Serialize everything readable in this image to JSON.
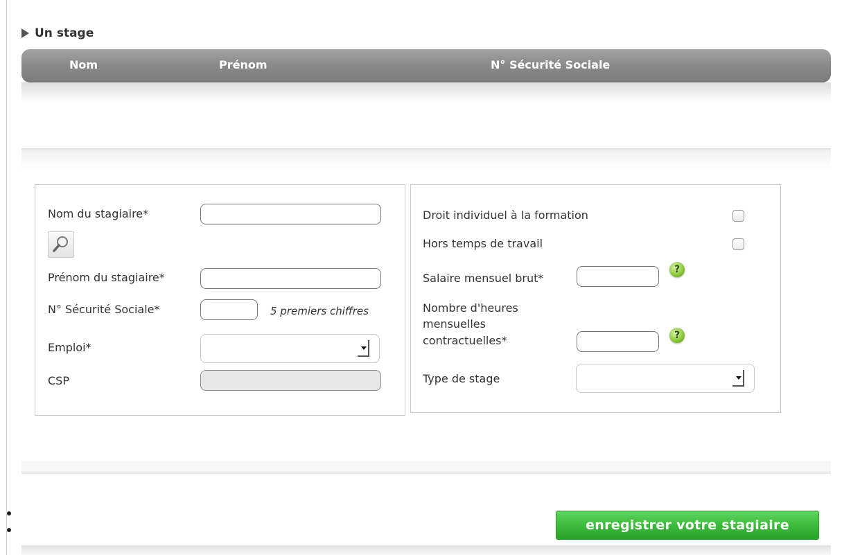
{
  "section": {
    "title": "Un stage"
  },
  "table": {
    "columns": [
      "Nom",
      "Prénom",
      "N° Sécurité Sociale"
    ]
  },
  "left_panel": {
    "nom_label": "Nom du stagiaire*",
    "nom_value": "",
    "lookup_icon": "magnifier-icon",
    "prenom_label": "Prénom du stagiaire*",
    "prenom_value": "",
    "nss_label": "N° Sécurité Sociale*",
    "nss_value": "",
    "nss_hint": "5 premiers chiffres",
    "emploi_label": "Emploi*",
    "emploi_value": "",
    "csp_label": "CSP",
    "csp_value": ""
  },
  "right_panel": {
    "dif_label": "Droit individuel à la formation",
    "dif_checked": false,
    "htt_label": "Hors temps de travail",
    "htt_checked": false,
    "salaire_label": "Salaire mensuel brut*",
    "salaire_value": "",
    "heures_label_lines": [
      "Nombre d'heures",
      "mensuelles",
      "contractuelles*"
    ],
    "heures_value": "",
    "help_icon": "question-help-icon",
    "help_glyph": "?",
    "type_label": "Type de stage",
    "type_value": ""
  },
  "actions": {
    "save_label": "enregistrer votre stagiaire"
  },
  "colors": {
    "accent_green": "#3cbb3c",
    "header_gray": "#8b8b8b"
  }
}
